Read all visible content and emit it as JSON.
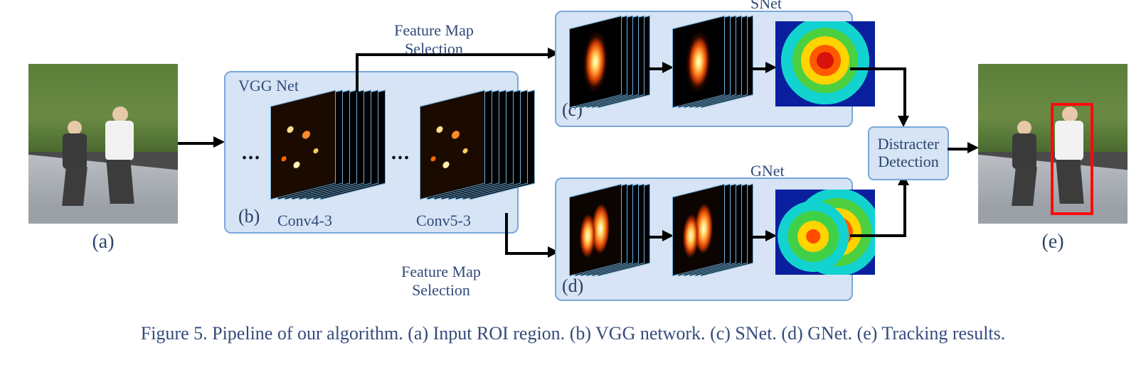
{
  "figure_number": "Figure 5.",
  "caption_main": "Pipeline of our algorithm.",
  "caption_parts": {
    "a": "(a) Input ROI region.",
    "b": "(b) VGG network.",
    "c": "(c) SNet.",
    "d": "(d) GNet.",
    "e": "(e) Tracking results."
  },
  "panel_letters": {
    "a": "(a)",
    "b": "(b)",
    "c": "(c)",
    "d": "(d)",
    "e": "(e)"
  },
  "labels": {
    "vgg_net": "VGG Net",
    "conv4_3": "Conv4-3",
    "conv5_3": "Conv5-3",
    "feature_map_selection_top": "Feature Map\nSelection",
    "feature_map_selection_bottom": "Feature Map\nSelection",
    "snet": "SNet",
    "gnet": "GNet",
    "distracter_detection": "Distracter\nDetection"
  },
  "dots": "...",
  "semantic": {
    "input_description": "Two people jogging on a path with grass background",
    "output_description": "Same scene with red bounding box around the right jogger (target)",
    "snet_output": "single-peak heatmap centered on target",
    "gnet_output": "double-peak heatmap including distracter"
  }
}
